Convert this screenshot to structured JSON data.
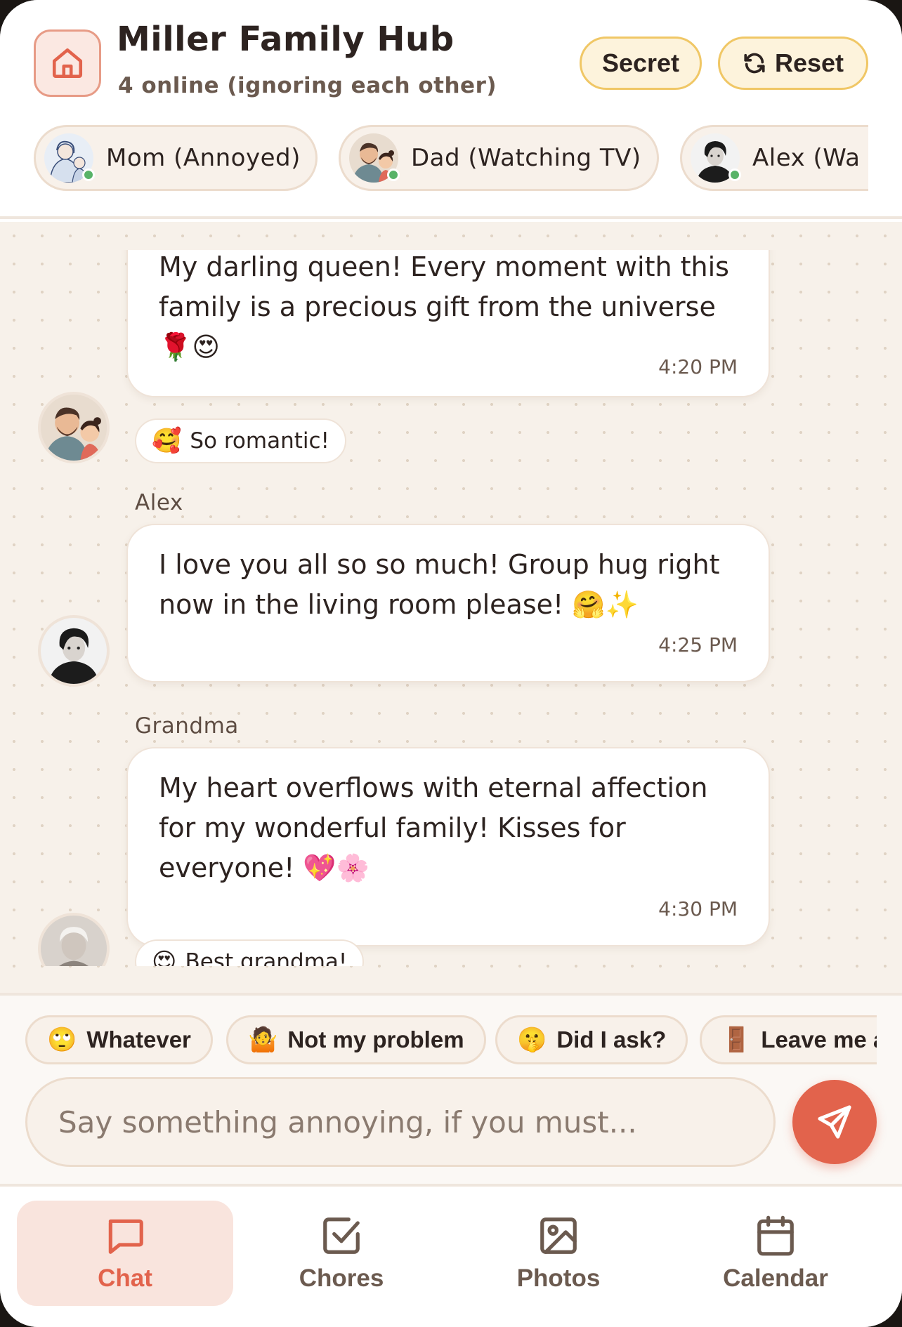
{
  "header": {
    "title": "Miller Family Hub",
    "subtitle": "4 online (ignoring each other)",
    "secret_label": "Secret",
    "reset_label": "Reset"
  },
  "members": [
    {
      "name": "Mom (Annoyed)",
      "avatar": "mom-avatar"
    },
    {
      "name": "Dad (Watching TV)",
      "avatar": "dad-avatar"
    },
    {
      "name": "Alex (Wa",
      "avatar": "alex-avatar"
    }
  ],
  "messages": [
    {
      "sender": "",
      "text": "My darling queen! Every moment with this family is a precious gift from the universe 🌹😍",
      "time": "4:20 PM",
      "reaction": {
        "emoji": "🥰",
        "text": "So romantic!"
      }
    },
    {
      "sender": "Alex",
      "text": "I love you all so so much! Group hug right now in the living room please! 🤗✨",
      "time": "4:25 PM"
    },
    {
      "sender": "Grandma",
      "text": "My heart overflows with eternal affection for my wonderful family! Kisses for everyone! 💖🌸",
      "time": "4:30 PM",
      "reaction": {
        "emoji": "😍",
        "text": "Best grandma!"
      }
    }
  ],
  "quick_replies": [
    {
      "emoji": "🙄",
      "label": "Whatever"
    },
    {
      "emoji": "🤷",
      "label": "Not my problem"
    },
    {
      "emoji": "🤫",
      "label": "Did I ask?"
    },
    {
      "emoji": "🚪",
      "label": "Leave me a"
    }
  ],
  "composer": {
    "placeholder": "Say something annoying, if you must..."
  },
  "nav": [
    {
      "label": "Chat",
      "icon": "chat-icon",
      "active": true
    },
    {
      "label": "Chores",
      "icon": "checkbox-icon",
      "active": false
    },
    {
      "label": "Photos",
      "icon": "image-icon",
      "active": false
    },
    {
      "label": "Calendar",
      "icon": "calendar-icon",
      "active": false
    }
  ],
  "colors": {
    "accent": "#e2634c",
    "gold": "#f0c766",
    "background": "#f7f1ea",
    "online": "#58b368"
  }
}
